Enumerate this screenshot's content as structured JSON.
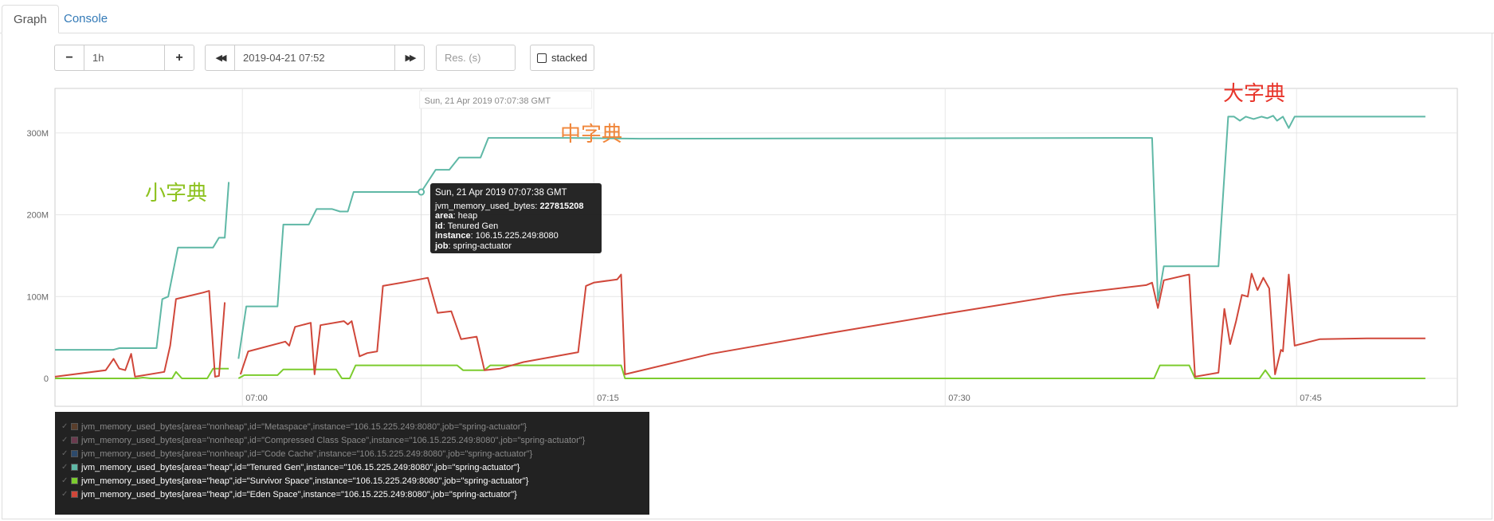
{
  "tabs": [
    {
      "label": "Graph",
      "active": true
    },
    {
      "label": "Console",
      "active": false
    }
  ],
  "controls": {
    "minus": "−",
    "range": "1h",
    "plus": "+",
    "back": "◀◀",
    "end_time": "2019-04-21 07:52",
    "forward": "▶▶",
    "resolution_placeholder": "Res. (s)",
    "stacked_label": "stacked"
  },
  "hover_time_label": "Sun, 21 Apr 2019 07:07:38 GMT",
  "tooltip": {
    "header": "Sun, 21 Apr 2019 07:07:38 GMT",
    "metric_name": "jvm_memory_used_bytes",
    "metric_value": "227815208",
    "labels": [
      {
        "key": "area",
        "value": "heap"
      },
      {
        "key": "id",
        "value": "Tenured Gen"
      },
      {
        "key": "instance",
        "value": "106.15.225.249:8080"
      },
      {
        "key": "job",
        "value": "spring-actuator"
      }
    ]
  },
  "annotations": [
    {
      "text": "小字典",
      "color": "#8dc21f"
    },
    {
      "text": "中字典",
      "color": "#f0863a"
    },
    {
      "text": "大字典",
      "color": "#e8352b"
    }
  ],
  "legend": [
    {
      "label": "jvm_memory_used_bytes{area=\"nonheap\",id=\"Metaspace\",instance=\"106.15.225.249:8080\",job=\"spring-actuator\"}",
      "color": "#5a3e2b",
      "active": false
    },
    {
      "label": "jvm_memory_used_bytes{area=\"nonheap\",id=\"Compressed Class Space\",instance=\"106.15.225.249:8080\",job=\"spring-actuator\"}",
      "color": "#6b3a4e",
      "active": false
    },
    {
      "label": "jvm_memory_used_bytes{area=\"nonheap\",id=\"Code Cache\",instance=\"106.15.225.249:8080\",job=\"spring-actuator\"}",
      "color": "#2d4a6b",
      "active": false
    },
    {
      "label": "jvm_memory_used_bytes{area=\"heap\",id=\"Tenured Gen\",instance=\"106.15.225.249:8080\",job=\"spring-actuator\"}",
      "color": "#5fb8a6",
      "active": true
    },
    {
      "label": "jvm_memory_used_bytes{area=\"heap\",id=\"Survivor Space\",instance=\"106.15.225.249:8080\",job=\"spring-actuator\"}",
      "color": "#7ccc2e",
      "active": true
    },
    {
      "label": "jvm_memory_used_bytes{area=\"heap\",id=\"Eden Space\",instance=\"106.15.225.249:8080\",job=\"spring-actuator\"}",
      "color": "#d0473a",
      "active": true
    }
  ],
  "chart_data": {
    "type": "line",
    "xlim": [
      "06:52",
      "07:52"
    ],
    "ylim": [
      0,
      350
    ],
    "unit": "M",
    "grid": true,
    "x_ticks": [
      {
        "t": "07:00",
        "label": "07:00"
      },
      {
        "t": "07:15",
        "label": "07:15"
      },
      {
        "t": "07:30",
        "label": "07:30"
      },
      {
        "t": "07:45",
        "label": "07:45"
      }
    ],
    "y_ticks": [
      {
        "v": 0,
        "label": "0"
      },
      {
        "v": 100,
        "label": "100M"
      },
      {
        "v": 200,
        "label": "200M"
      },
      {
        "v": 300,
        "label": "300M"
      }
    ],
    "hover_point": {
      "series": "Tenured Gen",
      "x": "07:07:38",
      "y": 227.8
    },
    "series": [
      {
        "name": "Tenured Gen",
        "color": "#5fb8a6",
        "segments": [
          [
            [
              "06:52:00",
              35
            ],
            [
              "06:54:30",
              35
            ],
            [
              "06:54:45",
              37
            ],
            [
              "06:56:20",
              37
            ],
            [
              "06:56:35",
              97
            ],
            [
              "06:56:50",
              100
            ],
            [
              "06:57:15",
              160
            ],
            [
              "06:58:45",
              160
            ],
            [
              "06:59:00",
              172
            ],
            [
              "06:59:15",
              172
            ],
            [
              "06:59:25",
              240
            ]
          ],
          [
            [
              "06:59:50",
              24
            ],
            [
              "07:00:10",
              88
            ],
            [
              "07:01:30",
              88
            ],
            [
              "07:01:45",
              188
            ],
            [
              "07:02:50",
              188
            ],
            [
              "07:03:10",
              207
            ],
            [
              "07:03:50",
              207
            ],
            [
              "07:04:10",
              204
            ],
            [
              "07:04:30",
              204
            ],
            [
              "07:04:45",
              227.8
            ],
            [
              "07:07:38",
              227.8
            ],
            [
              "07:08:15",
              255
            ],
            [
              "07:08:50",
              255
            ],
            [
              "07:09:15",
              270
            ],
            [
              "07:10:10",
              270
            ],
            [
              "07:10:30",
              294
            ],
            [
              "07:14:00",
              294
            ],
            [
              "07:17:00",
              293
            ],
            [
              "07:38:50",
              294
            ],
            [
              "07:39:05",
              95
            ],
            [
              "07:39:20",
              137
            ],
            [
              "07:41:40",
              137
            ],
            [
              "07:42:05",
              320
            ],
            [
              "07:42:20",
              320
            ],
            [
              "07:42:35",
              315
            ],
            [
              "07:42:50",
              320
            ],
            [
              "07:43:10",
              317
            ],
            [
              "07:43:30",
              320
            ],
            [
              "07:43:45",
              318
            ],
            [
              "07:44:00",
              321
            ],
            [
              "07:44:10",
              315
            ],
            [
              "07:44:25",
              320
            ],
            [
              "07:44:40",
              306
            ],
            [
              "07:44:55",
              320
            ],
            [
              "07:50:30",
              320
            ]
          ]
        ]
      },
      {
        "name": "Survivor Space",
        "color": "#7ccc2e",
        "segments": [
          [
            [
              "06:52:00",
              0
            ],
            [
              "06:55:30",
              0
            ],
            [
              "06:55:45",
              1
            ],
            [
              "06:56:05",
              0
            ],
            [
              "06:57:00",
              0
            ],
            [
              "06:57:10",
              8
            ],
            [
              "06:57:25",
              0
            ],
            [
              "06:58:30",
              0
            ],
            [
              "06:58:45",
              12
            ],
            [
              "06:59:25",
              12
            ]
          ],
          [
            [
              "06:59:50",
              0
            ],
            [
              "07:00:05",
              4
            ],
            [
              "07:01:30",
              4
            ],
            [
              "07:01:45",
              11
            ],
            [
              "07:04:00",
              11
            ],
            [
              "07:04:15",
              0
            ],
            [
              "07:04:35",
              0
            ],
            [
              "07:04:50",
              16
            ],
            [
              "07:09:10",
              16
            ],
            [
              "07:09:25",
              10
            ],
            [
              "07:10:20",
              10
            ],
            [
              "07:10:35",
              16
            ],
            [
              "07:16:10",
              16
            ],
            [
              "07:16:20",
              0
            ],
            [
              "07:38:55",
              0
            ],
            [
              "07:39:10",
              16
            ],
            [
              "07:40:25",
              16
            ],
            [
              "07:40:40",
              0
            ],
            [
              "07:42:30",
              0
            ],
            [
              "07:42:40",
              0
            ],
            [
              "07:43:25",
              0
            ],
            [
              "07:43:40",
              10
            ],
            [
              "07:43:55",
              0
            ],
            [
              "07:50:30",
              0
            ]
          ]
        ]
      },
      {
        "name": "Eden Space",
        "color": "#d0473a",
        "segments": [
          [
            [
              "06:52:00",
              2
            ],
            [
              "06:54:10",
              10
            ],
            [
              "06:54:30",
              24
            ],
            [
              "06:54:45",
              12
            ],
            [
              "06:55:00",
              10
            ],
            [
              "06:55:15",
              30
            ],
            [
              "06:55:25",
              2
            ],
            [
              "06:56:40",
              8
            ],
            [
              "06:56:55",
              40
            ],
            [
              "06:57:10",
              97
            ],
            [
              "06:58:20",
              105
            ],
            [
              "06:58:35",
              107
            ],
            [
              "06:58:50",
              2
            ],
            [
              "06:59:00",
              3
            ],
            [
              "06:59:15",
              93
            ]
          ],
          [
            [
              "06:59:55",
              5
            ],
            [
              "07:00:15",
              33
            ],
            [
              "07:01:50",
              45
            ],
            [
              "07:02:00",
              40
            ],
            [
              "07:02:15",
              63
            ],
            [
              "07:02:55",
              68
            ],
            [
              "07:03:05",
              5
            ],
            [
              "07:03:20",
              65
            ],
            [
              "07:04:20",
              70
            ],
            [
              "07:04:30",
              66
            ],
            [
              "07:04:40",
              70
            ],
            [
              "07:05:00",
              27
            ],
            [
              "07:05:20",
              31
            ],
            [
              "07:05:45",
              33
            ],
            [
              "07:06:00",
              113
            ],
            [
              "07:07:00",
              118
            ],
            [
              "07:07:55",
              123
            ],
            [
              "07:08:20",
              80
            ],
            [
              "07:08:55",
              82
            ],
            [
              "07:09:20",
              48
            ],
            [
              "07:10:00",
              51
            ],
            [
              "07:10:20",
              10
            ],
            [
              "07:11:00",
              12
            ],
            [
              "07:12:00",
              20
            ],
            [
              "07:14:20",
              32
            ],
            [
              "07:14:40",
              113
            ],
            [
              "07:15:00",
              117
            ],
            [
              "07:16:00",
              121
            ],
            [
              "07:16:10",
              127
            ],
            [
              "07:16:20",
              5
            ],
            [
              "07:20:00",
              30
            ],
            [
              "07:25:00",
              55
            ],
            [
              "07:30:00",
              79
            ],
            [
              "07:35:00",
              102
            ],
            [
              "07:38:35",
              114
            ],
            [
              "07:38:50",
              117
            ],
            [
              "07:39:05",
              86
            ],
            [
              "07:39:20",
              120
            ],
            [
              "07:40:15",
              126
            ],
            [
              "07:40:25",
              127
            ],
            [
              "07:40:40",
              2
            ],
            [
              "07:41:40",
              7
            ],
            [
              "07:41:55",
              85
            ],
            [
              "07:42:10",
              42
            ],
            [
              "07:42:25",
              70
            ],
            [
              "07:42:40",
              102
            ],
            [
              "07:42:55",
              100
            ],
            [
              "07:43:05",
              128
            ],
            [
              "07:43:20",
              108
            ],
            [
              "07:43:35",
              123
            ],
            [
              "07:43:50",
              110
            ],
            [
              "07:44:05",
              5
            ],
            [
              "07:44:20",
              35
            ],
            [
              "07:44:25",
              33
            ],
            [
              "07:44:40",
              127
            ],
            [
              "07:44:55",
              40
            ],
            [
              "07:46:00",
              48
            ],
            [
              "07:48:00",
              49
            ],
            [
              "07:50:30",
              49
            ]
          ]
        ]
      }
    ]
  }
}
